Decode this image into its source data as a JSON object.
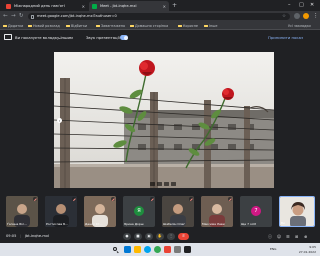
{
  "browser": {
    "tabs": [
      {
        "label": "Міжнародний день пам'яті",
        "favicon_color": "#ea4335"
      },
      {
        "label": "Meet - jbt-inqhe-mxl",
        "favicon_color": "#00ac47"
      }
    ],
    "new_tab_label": "+",
    "window_controls": {
      "minimize": "–",
      "maximize": "□",
      "close": "✕"
    },
    "address_bar": {
      "url": "meet.google.com/jbt-inqhe-mxl?authuser=0"
    },
    "bookmarks": [
      "Додатки",
      "Новий розклад",
      "Відбитки",
      "Завантажено",
      "Домашня сторінка",
      "Корисне",
      "Інше"
    ],
    "bookmarks_right": "Усі закладки"
  },
  "meet": {
    "presenting_text": "Ви показуєте вкладку іншим",
    "share_audio_label": "Звук презентації",
    "stop_sharing_label": "Припинити показ",
    "participants": [
      {
        "name": "Ґалина Біл...",
        "initial": "",
        "avatar_color": "#3c4043",
        "has_video": true
      },
      {
        "name": "Ростислав Б...",
        "initial": "",
        "avatar_color": "#3c4043",
        "has_video": true
      },
      {
        "name": "Денис Ст...",
        "initial": "",
        "avatar_color": "#3c4043",
        "has_video": true
      },
      {
        "name": "Ярина Дорш",
        "initial": "Я",
        "avatar_color": "#1e8e3e",
        "has_video": false
      },
      {
        "name": "Шабелін Олег",
        "initial": "",
        "avatar_color": "#3c4043",
        "has_video": true
      },
      {
        "name": "Максима Леви",
        "initial": "",
        "avatar_color": "#3c4043",
        "has_video": true
      },
      {
        "name": "Ще 7 осіб",
        "initial": "7",
        "avatar_color": "#d01884",
        "has_video": false
      },
      {
        "name": "Ви",
        "initial": "",
        "avatar_color": "#3c4043",
        "has_video": true
      }
    ],
    "bottom_bar": {
      "time": "09:05",
      "separator": "|",
      "meeting_code": "jbt-inqhe-mxl",
      "controls": [
        "●",
        "■",
        "▣",
        "✋",
        "⋮",
        "✆"
      ],
      "right_tools": [
        "ⓘ",
        "☺",
        "☰",
        "⊞",
        "⊕"
      ]
    }
  },
  "taskbar": {
    "app_colors": [
      "#0078d4",
      "#ffb900",
      "#00a4ef",
      "#34a853",
      "#ea4335",
      "#7a7a7a",
      "#202124"
    ],
    "tray_text": "ENG",
    "time": "9:05",
    "date": "27.01.2022"
  }
}
